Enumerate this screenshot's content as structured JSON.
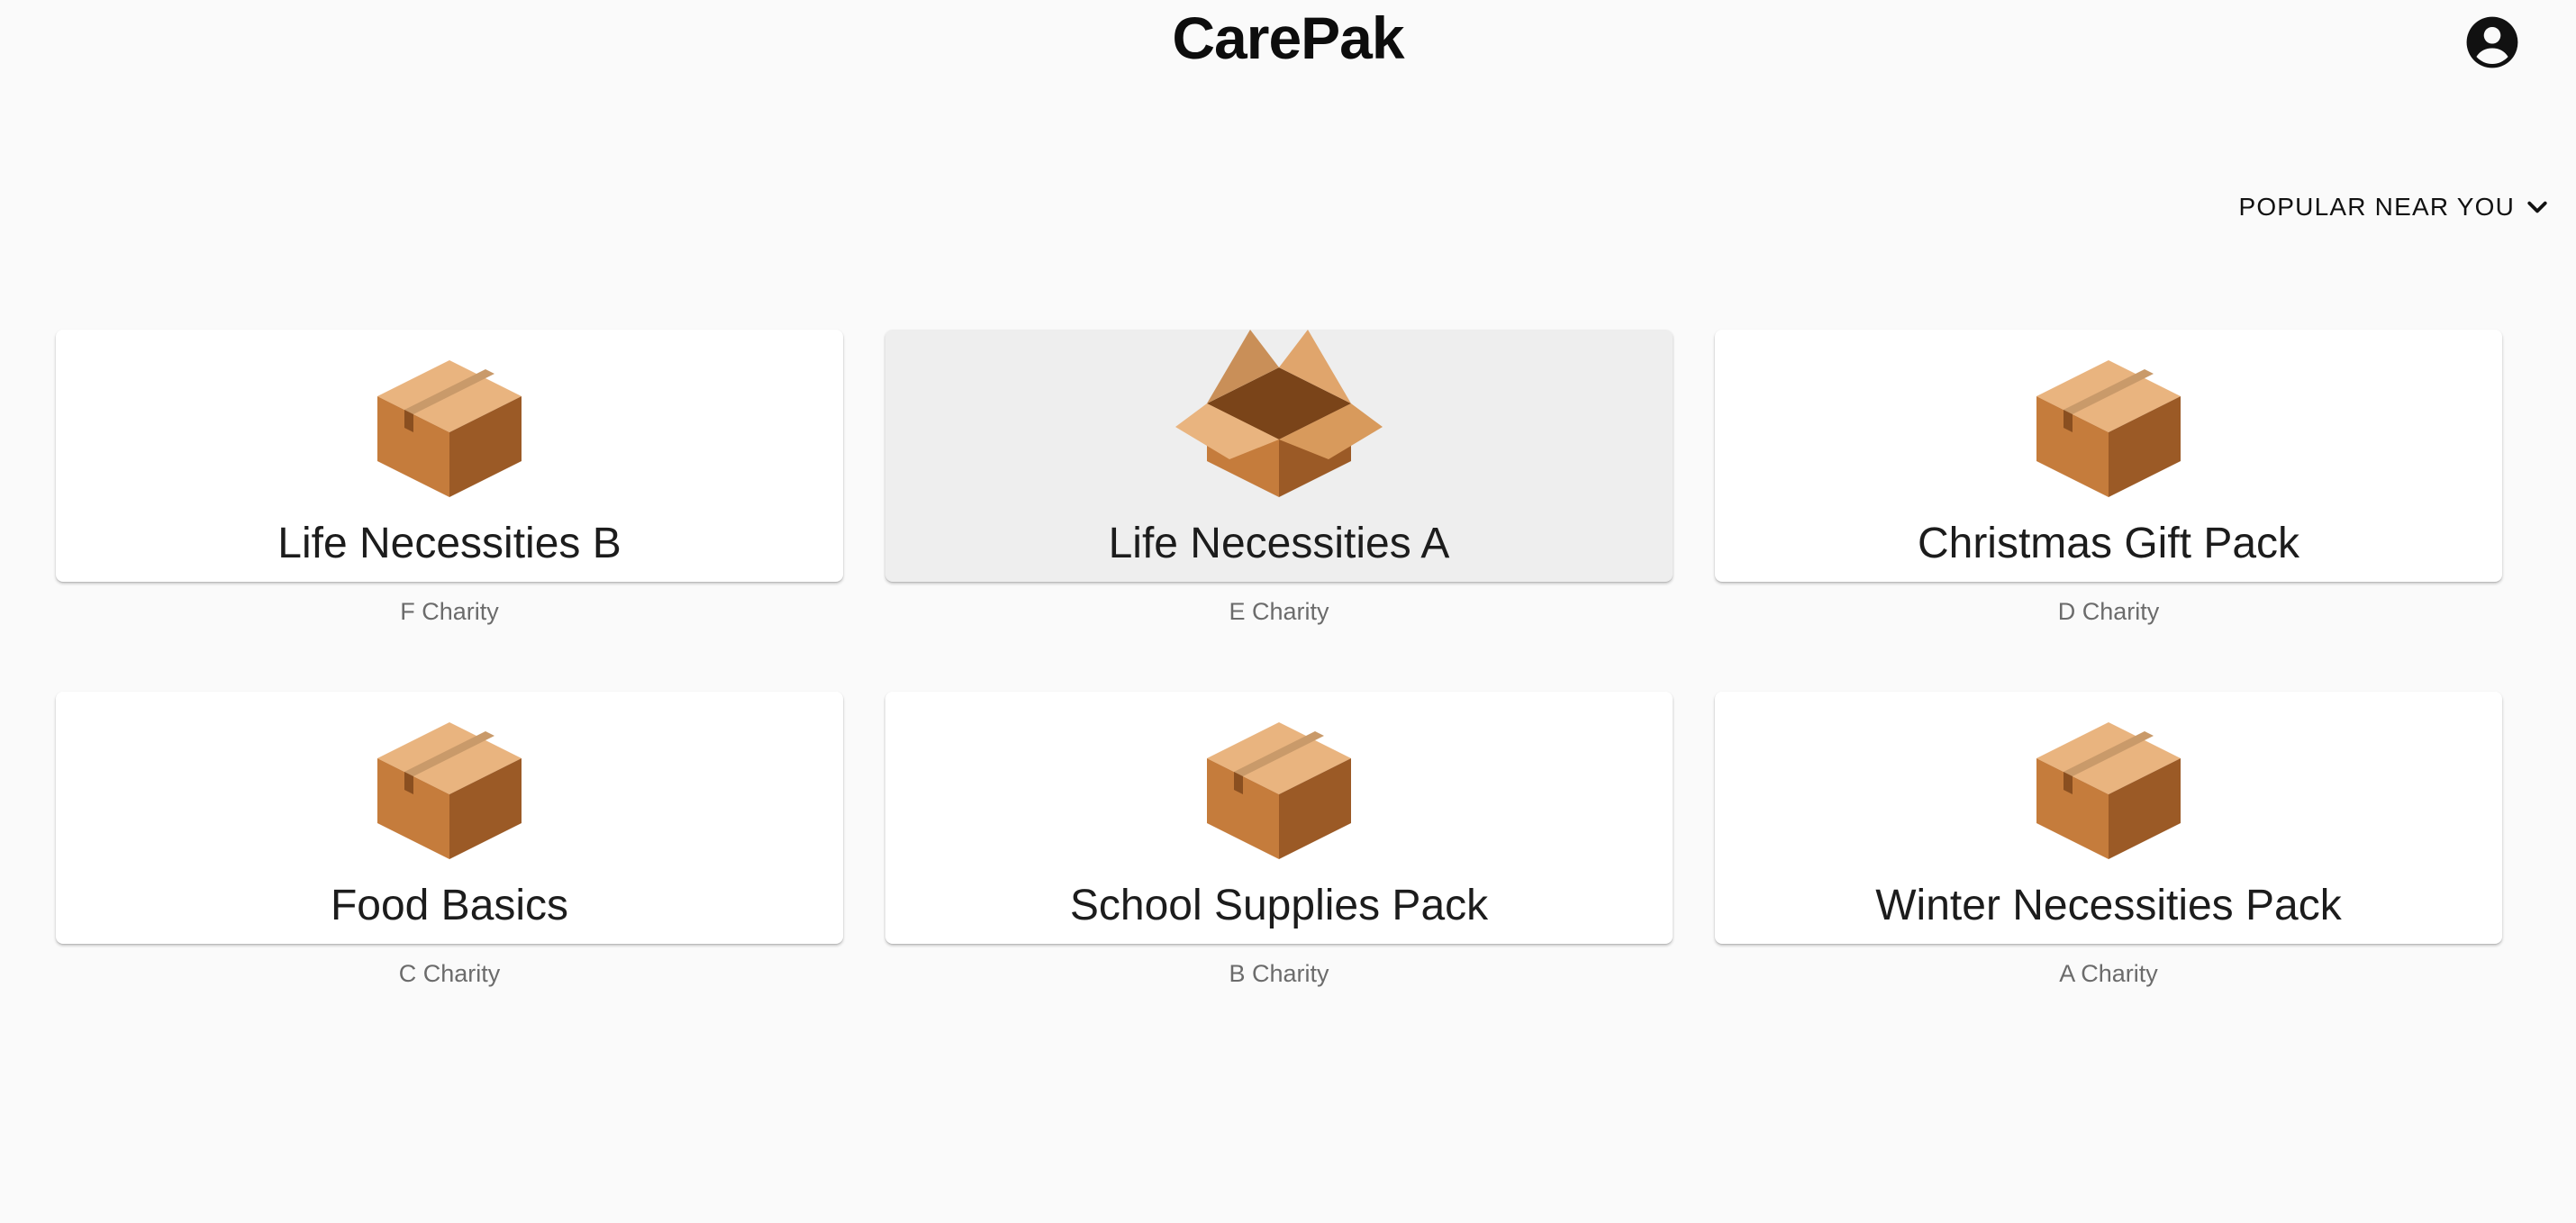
{
  "app": {
    "title": "CarePak"
  },
  "header": {
    "account_icon": "account-circle-icon"
  },
  "sort": {
    "label": "POPULAR NEAR YOU",
    "icon": "chevron-down-icon"
  },
  "packs": [
    {
      "title": "Life Necessities B",
      "charity": "F Charity",
      "icon": "closed-box-icon"
    },
    {
      "title": "Life Necessities A",
      "charity": "E Charity",
      "icon": "open-box-icon"
    },
    {
      "title": "Christmas Gift Pack",
      "charity": "D Charity",
      "icon": "closed-box-icon"
    },
    {
      "title": "Food Basics",
      "charity": "C Charity",
      "icon": "closed-box-icon"
    },
    {
      "title": "School Supplies Pack",
      "charity": "B Charity",
      "icon": "closed-box-icon"
    },
    {
      "title": "Winter Necessities Pack",
      "charity": "A Charity",
      "icon": "closed-box-icon"
    }
  ],
  "colors": {
    "background": "#fafafa",
    "card": "#ffffff",
    "card_hover": "#eeeeee",
    "box_light": "#e8b07a",
    "box_mid": "#c47b3a",
    "box_dark": "#9b5a26"
  }
}
